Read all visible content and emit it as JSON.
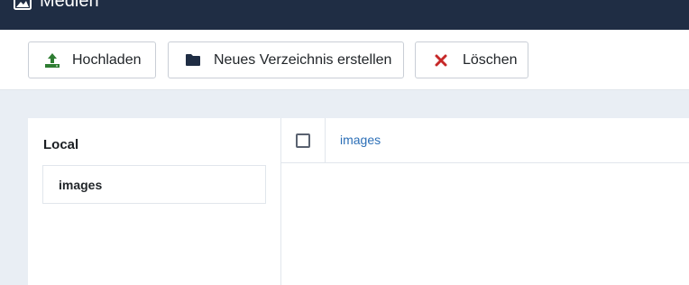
{
  "header": {
    "title": "Medien",
    "icon": "image-icon"
  },
  "toolbar": {
    "upload_label": "Hochladen",
    "upload_icon": "upload-icon",
    "new_folder_label": "Neues Verzeichnis erstellen",
    "new_folder_icon": "folder-icon",
    "delete_label": "Löschen",
    "delete_icon": "close-icon"
  },
  "sidebar": {
    "heading": "Local",
    "items": [
      {
        "label": "images"
      }
    ]
  },
  "browser": {
    "rows": [
      {
        "name": "images",
        "checked": false
      }
    ]
  },
  "colors": {
    "header_bg": "#1f2d44",
    "upload_icon": "#2e7d32",
    "delete_icon": "#c62828",
    "link": "#2c6fb7"
  }
}
